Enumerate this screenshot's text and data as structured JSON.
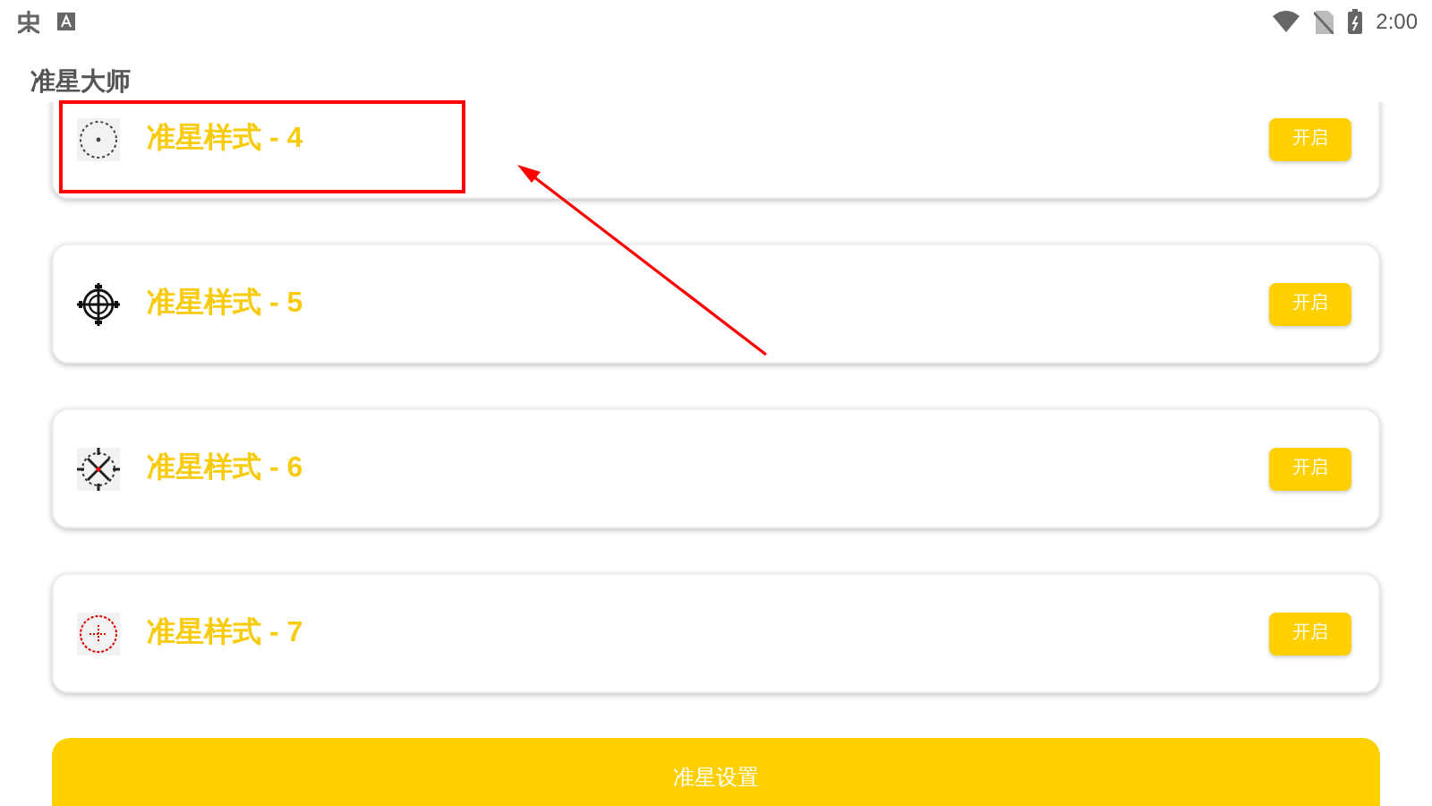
{
  "status_bar": {
    "time": "2:00"
  },
  "app_bar": {
    "title": "准星大师"
  },
  "styles": [
    {
      "label": "准星样式 - 4",
      "button": "开启",
      "highlighted": true
    },
    {
      "label": "准星样式 - 5",
      "button": "开启",
      "highlighted": false
    },
    {
      "label": "准星样式 - 6",
      "button": "开启",
      "highlighted": false
    },
    {
      "label": "准星样式 - 7",
      "button": "开启",
      "highlighted": false
    }
  ],
  "settings_button": "准星设置"
}
